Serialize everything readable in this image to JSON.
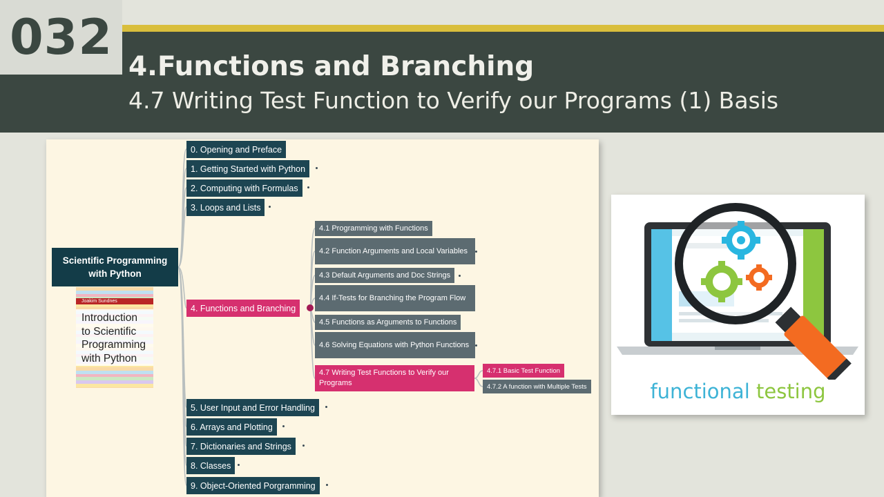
{
  "slide_number": "032",
  "title": "4.Functions and Branching",
  "subtitle": "4.7 Writing Test Function to Verify our Programs (1) Basis",
  "mindmap": {
    "root": "Scientific Programming with Python",
    "book": {
      "author": "Joakim Sundnes",
      "title": "Introduction to Scientific Programming with Python"
    },
    "chapters": [
      "0. Opening and Preface",
      "1. Getting Started with Python",
      "2. Computing with Formulas",
      "3. Loops and Lists",
      "4. Functions and Branching",
      "5. User Input and Error Handling",
      "6. Arrays and Plotting",
      "7. Dictionaries and Strings",
      "8. Classes",
      "9. Object-Oriented Porgramming"
    ],
    "sections": [
      "4.1 Programming with Functions",
      "4.2 Function Arguments and Local Variables",
      "4.3 Default Arguments and Doc Strings",
      "4.4 If-Tests for Branching the Program Flow",
      "4.5 Functions as Arguments to Functions",
      "4.6 Solving Equations with Python Functions",
      "4.7 Writing Test Functions to Verify our Programs"
    ],
    "subsections": [
      "4.7.1 Basic Test Function",
      "4.7.2 A function with Multiple Tests"
    ]
  },
  "illustration": {
    "caption_word1": "functional",
    "caption_word2": "testing",
    "colors": {
      "caption_blue": "#3db3d6",
      "caption_green": "#8dc63f",
      "handle_orange": "#f36b21",
      "gear_cyan": "#29b6e0",
      "gear_green": "#8dc63f",
      "gear_orange": "#f36b21"
    }
  },
  "colors": {
    "header_band": "#3b4741",
    "gold_stripe": "#d9be3c",
    "chapter_node": "#1d4552",
    "section_node": "#5c6b71",
    "active_node": "#d6306f",
    "panel_bg": "#fdf6e3"
  }
}
